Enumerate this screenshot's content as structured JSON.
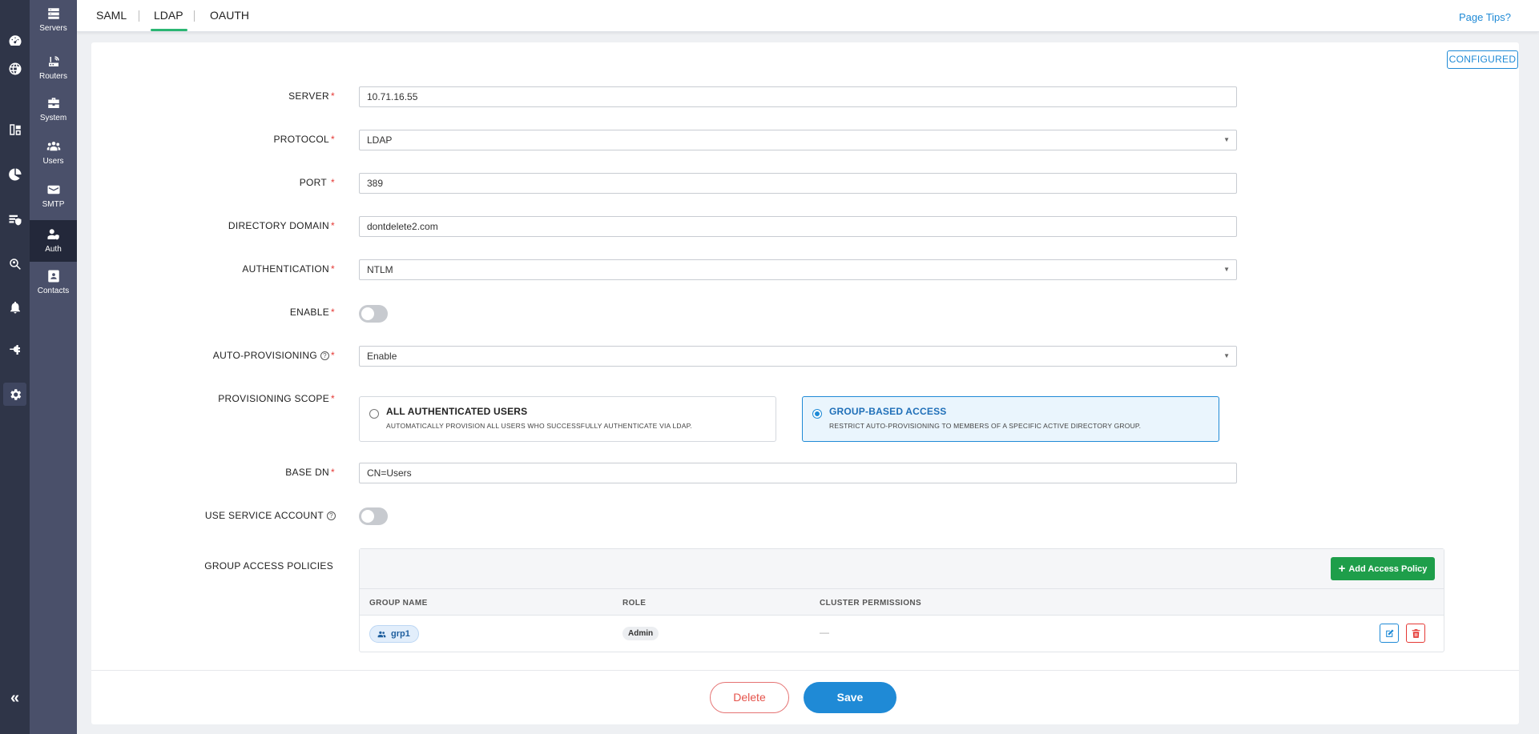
{
  "nav": {
    "rail": [
      {
        "name": "dashboard-icon"
      },
      {
        "name": "dns-icon"
      },
      {
        "name": "reports-icon"
      },
      {
        "name": "analytics-icon"
      },
      {
        "name": "policy-icon"
      },
      {
        "name": "investigate-icon"
      },
      {
        "name": "notification-icon"
      },
      {
        "name": "integration-icon"
      },
      {
        "name": "settings-icon",
        "active": true
      }
    ],
    "collapse_label": "«",
    "sub_items": [
      {
        "label": "Servers",
        "icon": "servers-icon"
      },
      {
        "label": "Routers",
        "icon": "routers-icon"
      },
      {
        "label": "System",
        "icon": "system-icon"
      },
      {
        "label": "Users",
        "icon": "users-icon"
      },
      {
        "label": "SMTP",
        "icon": "smtp-icon"
      },
      {
        "label": "Auth",
        "icon": "auth-icon",
        "active": true
      },
      {
        "label": "Contacts",
        "icon": "contacts-icon"
      }
    ]
  },
  "tabs": [
    {
      "label": "SAML"
    },
    {
      "label": "LDAP",
      "active": true
    },
    {
      "label": "OAUTH"
    }
  ],
  "page_tips": "Page Tips?",
  "status_badge": "CONFIGURED",
  "form": {
    "server": {
      "label": "SERVER",
      "value": "10.71.16.55"
    },
    "protocol": {
      "label": "PROTOCOL",
      "value": "LDAP"
    },
    "port": {
      "label": "PORT",
      "value": "389"
    },
    "directory_domain": {
      "label": "DIRECTORY DOMAIN",
      "value": "dontdelete2.com"
    },
    "authentication": {
      "label": "AUTHENTICATION",
      "value": "NTLM"
    },
    "enable": {
      "label": "ENABLE",
      "value": false
    },
    "auto_provisioning": {
      "label": "AUTO-PROVISIONING",
      "value": "Enable"
    },
    "provisioning_scope": {
      "label": "PROVISIONING SCOPE",
      "options": [
        {
          "title": "ALL AUTHENTICATED USERS",
          "description": "AUTOMATICALLY PROVISION ALL USERS WHO SUCCESSFULLY AUTHENTICATE VIA LDAP.",
          "selected": false
        },
        {
          "title": "GROUP-BASED ACCESS",
          "description": "RESTRICT AUTO-PROVISIONING TO MEMBERS OF A SPECIFIC ACTIVE DIRECTORY GROUP.",
          "selected": true
        }
      ]
    },
    "base_dn": {
      "label": "BASE DN",
      "value": "CN=Users"
    },
    "use_service_account": {
      "label": "USE SERVICE ACCOUNT",
      "value": false
    },
    "required_mark": "*",
    "help_mark": "?"
  },
  "policies": {
    "label": "GROUP ACCESS POLICIES",
    "add_button": "Add Access Policy",
    "add_plus": "+",
    "columns": [
      "GROUP NAME",
      "ROLE",
      "CLUSTER PERMISSIONS"
    ],
    "rows": [
      {
        "group": "grp1",
        "role": "Admin",
        "permissions": "—"
      }
    ]
  },
  "actions": {
    "delete": "Delete",
    "save": "Save"
  }
}
